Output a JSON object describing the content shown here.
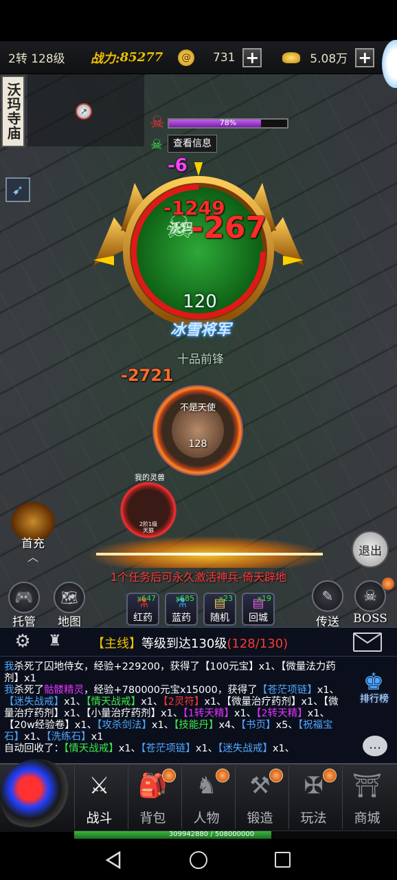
{
  "topbar": {
    "level": "2转 128级",
    "power_label": "战力:",
    "power_value": "85277",
    "currency1_value": "731",
    "currency2_value": "5.08万",
    "plus_glyph": "+"
  },
  "location": "沃玛寺庙",
  "boss": {
    "hp_percent_text": "78%",
    "hp_fraction": 0.78,
    "view_info": "查看信息",
    "level": "120",
    "title": "冰雪将军",
    "damage_small": "-6",
    "damage_mid": "-1249",
    "damage_big": "-267",
    "partial_name": "沃玛"
  },
  "player": {
    "name": "不是天使",
    "level": "128",
    "title": "十品前锋",
    "damage": "-2721"
  },
  "pet": {
    "label": "我的灵兽",
    "sub1": "2阶1级",
    "sub2": "天狼"
  },
  "left_buttons": {
    "first_charge": "首充"
  },
  "exit_button": "退出",
  "banner": {
    "prefix": "1个任务后可永久激活",
    "highlight": "神兵-倚天辟地"
  },
  "actions": {
    "auto": "托管",
    "map": "地图",
    "teleport": "传送",
    "boss": "BOSS"
  },
  "potions": [
    {
      "name": "红药",
      "count": "x647"
    },
    {
      "name": "蓝药",
      "count": "x685"
    },
    {
      "name": "随机",
      "count": "x23"
    },
    {
      "name": "回城",
      "count": "x19"
    }
  ],
  "quest": {
    "tag": "【主线】",
    "text": "等级到达130级",
    "progress": "(128/130)"
  },
  "ranking": "排行榜",
  "chat": {
    "line1_a": "我",
    "line1_b": "杀死了囚地侍女，经验+229200，获得了【100元宝】x1、【微量法力药剂】x1",
    "line2_a": "我",
    "line2_b": "杀死了",
    "line2_c": "骷髅精灵",
    "line2_d": "，经验+780000元宝x15000，获得了",
    "items": [
      {
        "t": "【苍茫项链】",
        "c": "c-blue"
      },
      {
        "t": "x1、",
        "c": ""
      },
      {
        "t": "【迷失战戒】",
        "c": "c-blue"
      },
      {
        "t": "x1、",
        "c": ""
      },
      {
        "t": "【情天战戒】",
        "c": "c-green"
      },
      {
        "t": "x1、",
        "c": ""
      },
      {
        "t": "【2灵符】",
        "c": "c-red"
      },
      {
        "t": "x1、",
        "c": ""
      },
      {
        "t": "【微量治疗药剂】x1、【微量治疗药剂】x1、【小量治疗药剂】x1、",
        "c": ""
      },
      {
        "t": "【1转天精】",
        "c": "c-mag"
      },
      {
        "t": "x1、",
        "c": ""
      },
      {
        "t": "【2转天精】",
        "c": "c-mag"
      },
      {
        "t": "x1、",
        "c": ""
      },
      {
        "t": "【20w经验卷】x1、",
        "c": ""
      },
      {
        "t": "【攻杀剑法】",
        "c": "c-blue"
      },
      {
        "t": "x1、",
        "c": ""
      },
      {
        "t": "【技能丹】",
        "c": "c-green"
      },
      {
        "t": "x4、",
        "c": ""
      },
      {
        "t": "【书页】",
        "c": "c-blue"
      },
      {
        "t": "x5、",
        "c": ""
      },
      {
        "t": "【祝福宝石】",
        "c": "c-blue"
      },
      {
        "t": "x1、",
        "c": ""
      },
      {
        "t": "【洗练石】",
        "c": "c-blue"
      },
      {
        "t": "x1",
        "c": ""
      }
    ],
    "line3_a": "自动回收了：",
    "recycle": [
      {
        "t": "【情天战戒】",
        "c": "c-green"
      },
      {
        "t": "x1、",
        "c": ""
      },
      {
        "t": "【苍茫项链】",
        "c": "c-blue"
      },
      {
        "t": "x1、",
        "c": ""
      },
      {
        "t": "【迷失战戒】",
        "c": "c-blue"
      },
      {
        "t": "x1、",
        "c": ""
      }
    ]
  },
  "nav": [
    {
      "label": "战斗",
      "icon": "crossed-swords-icon",
      "dot": false,
      "active": true
    },
    {
      "label": "背包",
      "icon": "backpack-icon",
      "dot": true,
      "active": false
    },
    {
      "label": "人物",
      "icon": "helmet-icon",
      "dot": true,
      "active": false
    },
    {
      "label": "锻造",
      "icon": "anvil-icon",
      "dot": true,
      "active": false
    },
    {
      "label": "玩法",
      "icon": "wings-sword-icon",
      "dot": true,
      "active": false
    },
    {
      "label": "商城",
      "icon": "shop-icon",
      "dot": false,
      "active": false
    }
  ],
  "exp_bar": {
    "text": "309942880 / 508000000",
    "fraction": 0.61
  },
  "colors": {
    "gold": "#f0c000",
    "boss_green": "#1c8a24",
    "hp_purple": "#a63bd6",
    "damage_red": "#ff2a2a"
  }
}
